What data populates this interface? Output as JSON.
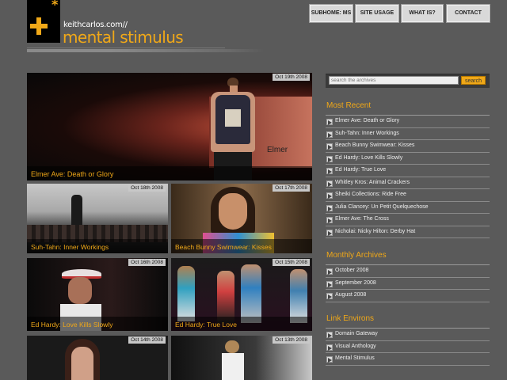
{
  "header": {
    "domain": "keithcarlos.com//",
    "title": "mental stimulus",
    "nav": [
      "SUBHOME: MS",
      "SITE USAGE",
      "WHAT IS?",
      "CONTACT"
    ]
  },
  "posts": [
    {
      "date": "Oct 19th 2008",
      "caption": "Elmer Ave: Death or Glory"
    },
    {
      "date": "Oct 18th 2008",
      "caption": "Suh-Tahn: Inner Workings"
    },
    {
      "date": "Oct 17th 2008",
      "caption": "Beach Bunny Swimwear: Kisses"
    },
    {
      "date": "Oct 16th 2008",
      "caption": "Ed Hardy: Love Kills Slowly"
    },
    {
      "date": "Oct 15th 2008",
      "caption": "Ed Hardy: True Love"
    },
    {
      "date": "Oct 14th 2008",
      "caption": ""
    },
    {
      "date": "Oct 13th 2008",
      "caption": ""
    }
  ],
  "sidebar": {
    "search_placeholder": "search the archives",
    "search_button": "search",
    "recent_title": "Most Recent",
    "recent": [
      "Elmer Ave: Death or Glory",
      "Suh-Tahn: Inner Workings",
      "Beach Bunny Swimwear: Kisses",
      "Ed Hardy: Love Kills Slowly",
      "Ed Hardy: True Love",
      "Whitley Kros: Animal Crackers",
      "Sheiki Collections: Ride Free",
      "Julia Clancey: Un Petit Quelquechose",
      "Elmer Ave: The Cross",
      "Nicholai: Nicky Hilton: Derby Hat"
    ],
    "archives_title": "Monthly Archives",
    "archives": [
      "October 2008",
      "September 2008",
      "August 2008"
    ],
    "links_title": "Link Environs",
    "links": [
      "Domain Gateway",
      "Visual Anthology",
      "Mental Stimulus"
    ]
  },
  "colors": {
    "accent": "#f0a818",
    "background": "#5a5a5a"
  }
}
